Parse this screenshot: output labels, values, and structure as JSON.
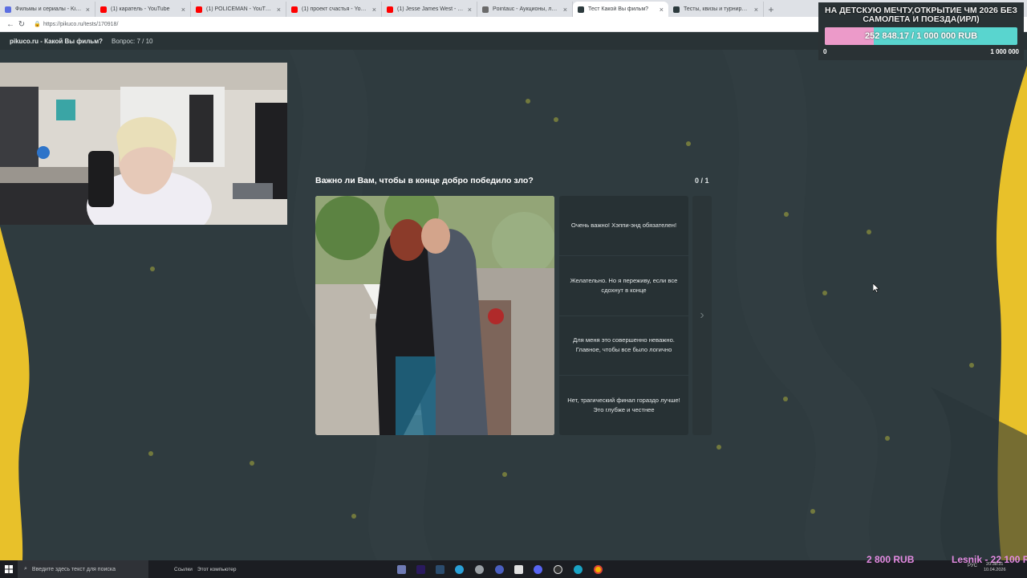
{
  "browser": {
    "tabs": [
      {
        "label": "Фильмы и сериалы - Kinobox.in",
        "color": "#5b6ee1"
      },
      {
        "label": "(1) каратель - YouTube",
        "color": "#ff0000"
      },
      {
        "label": "(1) POLICEMAN - YouTube",
        "color": "#ff0000"
      },
      {
        "label": "(1) проект счастья - YouTube",
        "color": "#ff0000"
      },
      {
        "label": "(1) Jesse James West - YouTube",
        "color": "#ff0000"
      },
      {
        "label": "Pointauc - Аукционы, лотереи и...",
        "color": "#6a6a6a"
      },
      {
        "label": "Тест Какой Вы фильм?",
        "color": "#2c3a3d"
      },
      {
        "label": "Тесты, квизы и турниры — Pikuc...",
        "color": "#2c3a3d"
      }
    ],
    "active_tab": 6,
    "close_glyph": "×",
    "new_tab_glyph": "+",
    "url": "https://pikuco.ru/tests/170918/"
  },
  "site": {
    "title": "pikuco.ru - Какой Вы фильм?",
    "question_counter": "Вопрос: 7 / 10"
  },
  "quiz": {
    "question": "Важно ли Вам, чтобы в конце добро победило зло?",
    "score": "0 / 1",
    "answers": [
      "Очень важно! Хэппи-энд обязателен!",
      "Желательно. Но я переживу, если все сдохнут в конце",
      "Для меня это совершенно неважно. Главное, чтобы все было логично",
      "Нет, трагический финал гораздо лучше! Это глубже и честнее"
    ],
    "next_icon": "chevron-right-icon"
  },
  "donation": {
    "title": "НА ДЕТСКУЮ МЕЧТУ,ОТКРЫТИЕ ЧМ 2026 БЕЗ САМОЛЕТА И ПОЕЗДА(ИРЛ)",
    "progress_text": "252 848.17 / 1 000 000 RUB",
    "progress_fraction": 0.2528,
    "min_label": "0",
    "max_label": "1 000 000",
    "fill_color": "#ec9ac9",
    "track_color": "#59d5cf"
  },
  "taskbar": {
    "search_placeholder": "Введите здесь текст для поиска",
    "links_label": "Ссылки",
    "computer_label": "Этот компьютер",
    "ticker_left": "2 800 RUB",
    "ticker_right": "Lesnik - 22 100 R",
    "tray_lang": "РУС",
    "time": "20:38:31",
    "date": "10.04.2026"
  },
  "colors": {
    "background": "#2f3b3f",
    "accent_yellow": "#e8c12a",
    "dot": "#8a8f3e"
  }
}
